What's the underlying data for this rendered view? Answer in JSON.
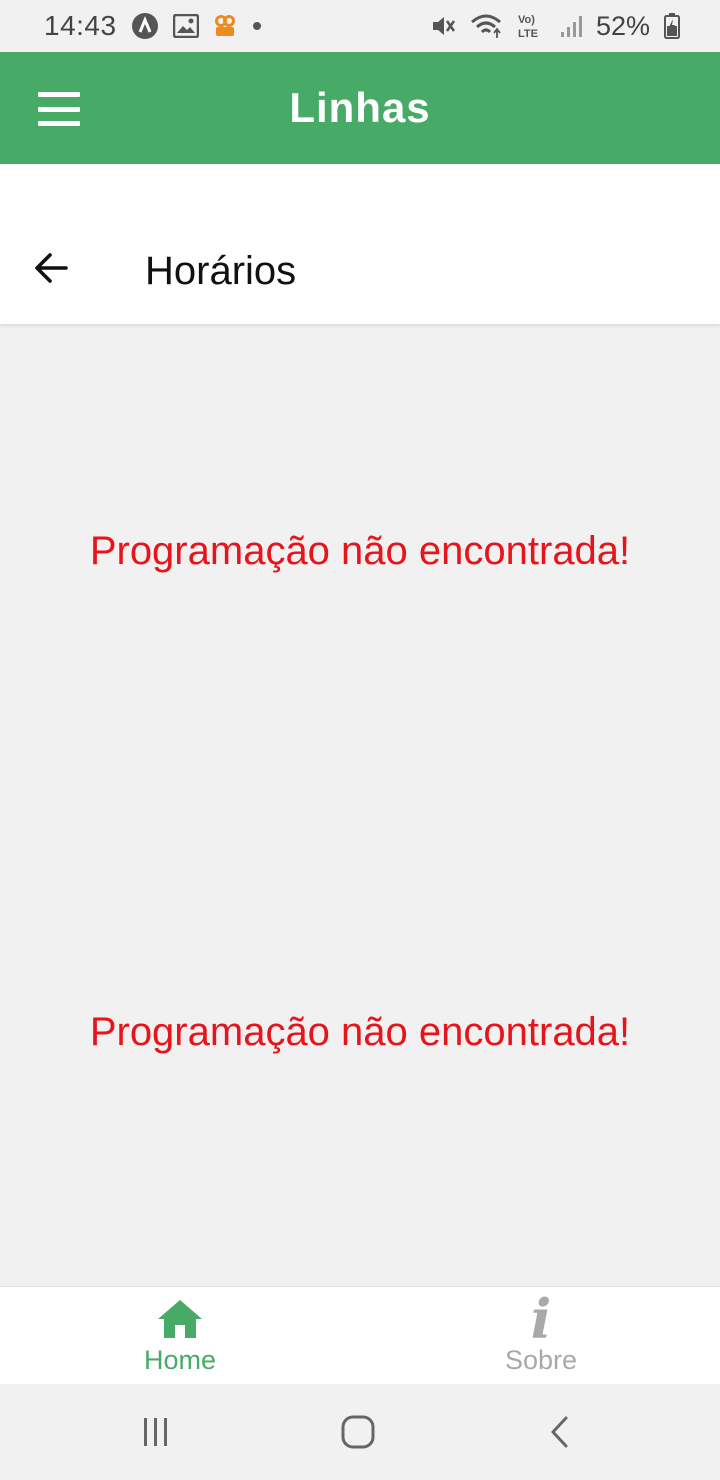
{
  "status_bar": {
    "time": "14:43",
    "battery_percent": "52%",
    "left_icons": [
      "app-a-icon",
      "image-icon",
      "video-app-icon",
      "dot-icon"
    ],
    "right_icons": [
      "mute-icon",
      "wifi-icon",
      "volte-lte-icon",
      "signal-icon",
      "battery-icon"
    ]
  },
  "app_bar": {
    "title": "Linhas",
    "background": "#47ab67",
    "menu_icon": "hamburger-menu-icon"
  },
  "sub_header": {
    "title": "Horários",
    "back_icon": "arrow-left-icon"
  },
  "messages": [
    {
      "text": "Programação não encontrada!"
    },
    {
      "text": "Programação não encontrada!"
    }
  ],
  "message_color": "#e8141b",
  "bottom_nav": {
    "items": [
      {
        "label": "Home",
        "icon": "home-icon",
        "active": true,
        "color": "#47ab67"
      },
      {
        "label": "Sobre",
        "icon": "info-icon",
        "active": false,
        "color": "#a9a9a9"
      }
    ]
  },
  "system_nav": [
    "recents-icon",
    "home-circle-icon",
    "back-chevron-icon"
  ]
}
